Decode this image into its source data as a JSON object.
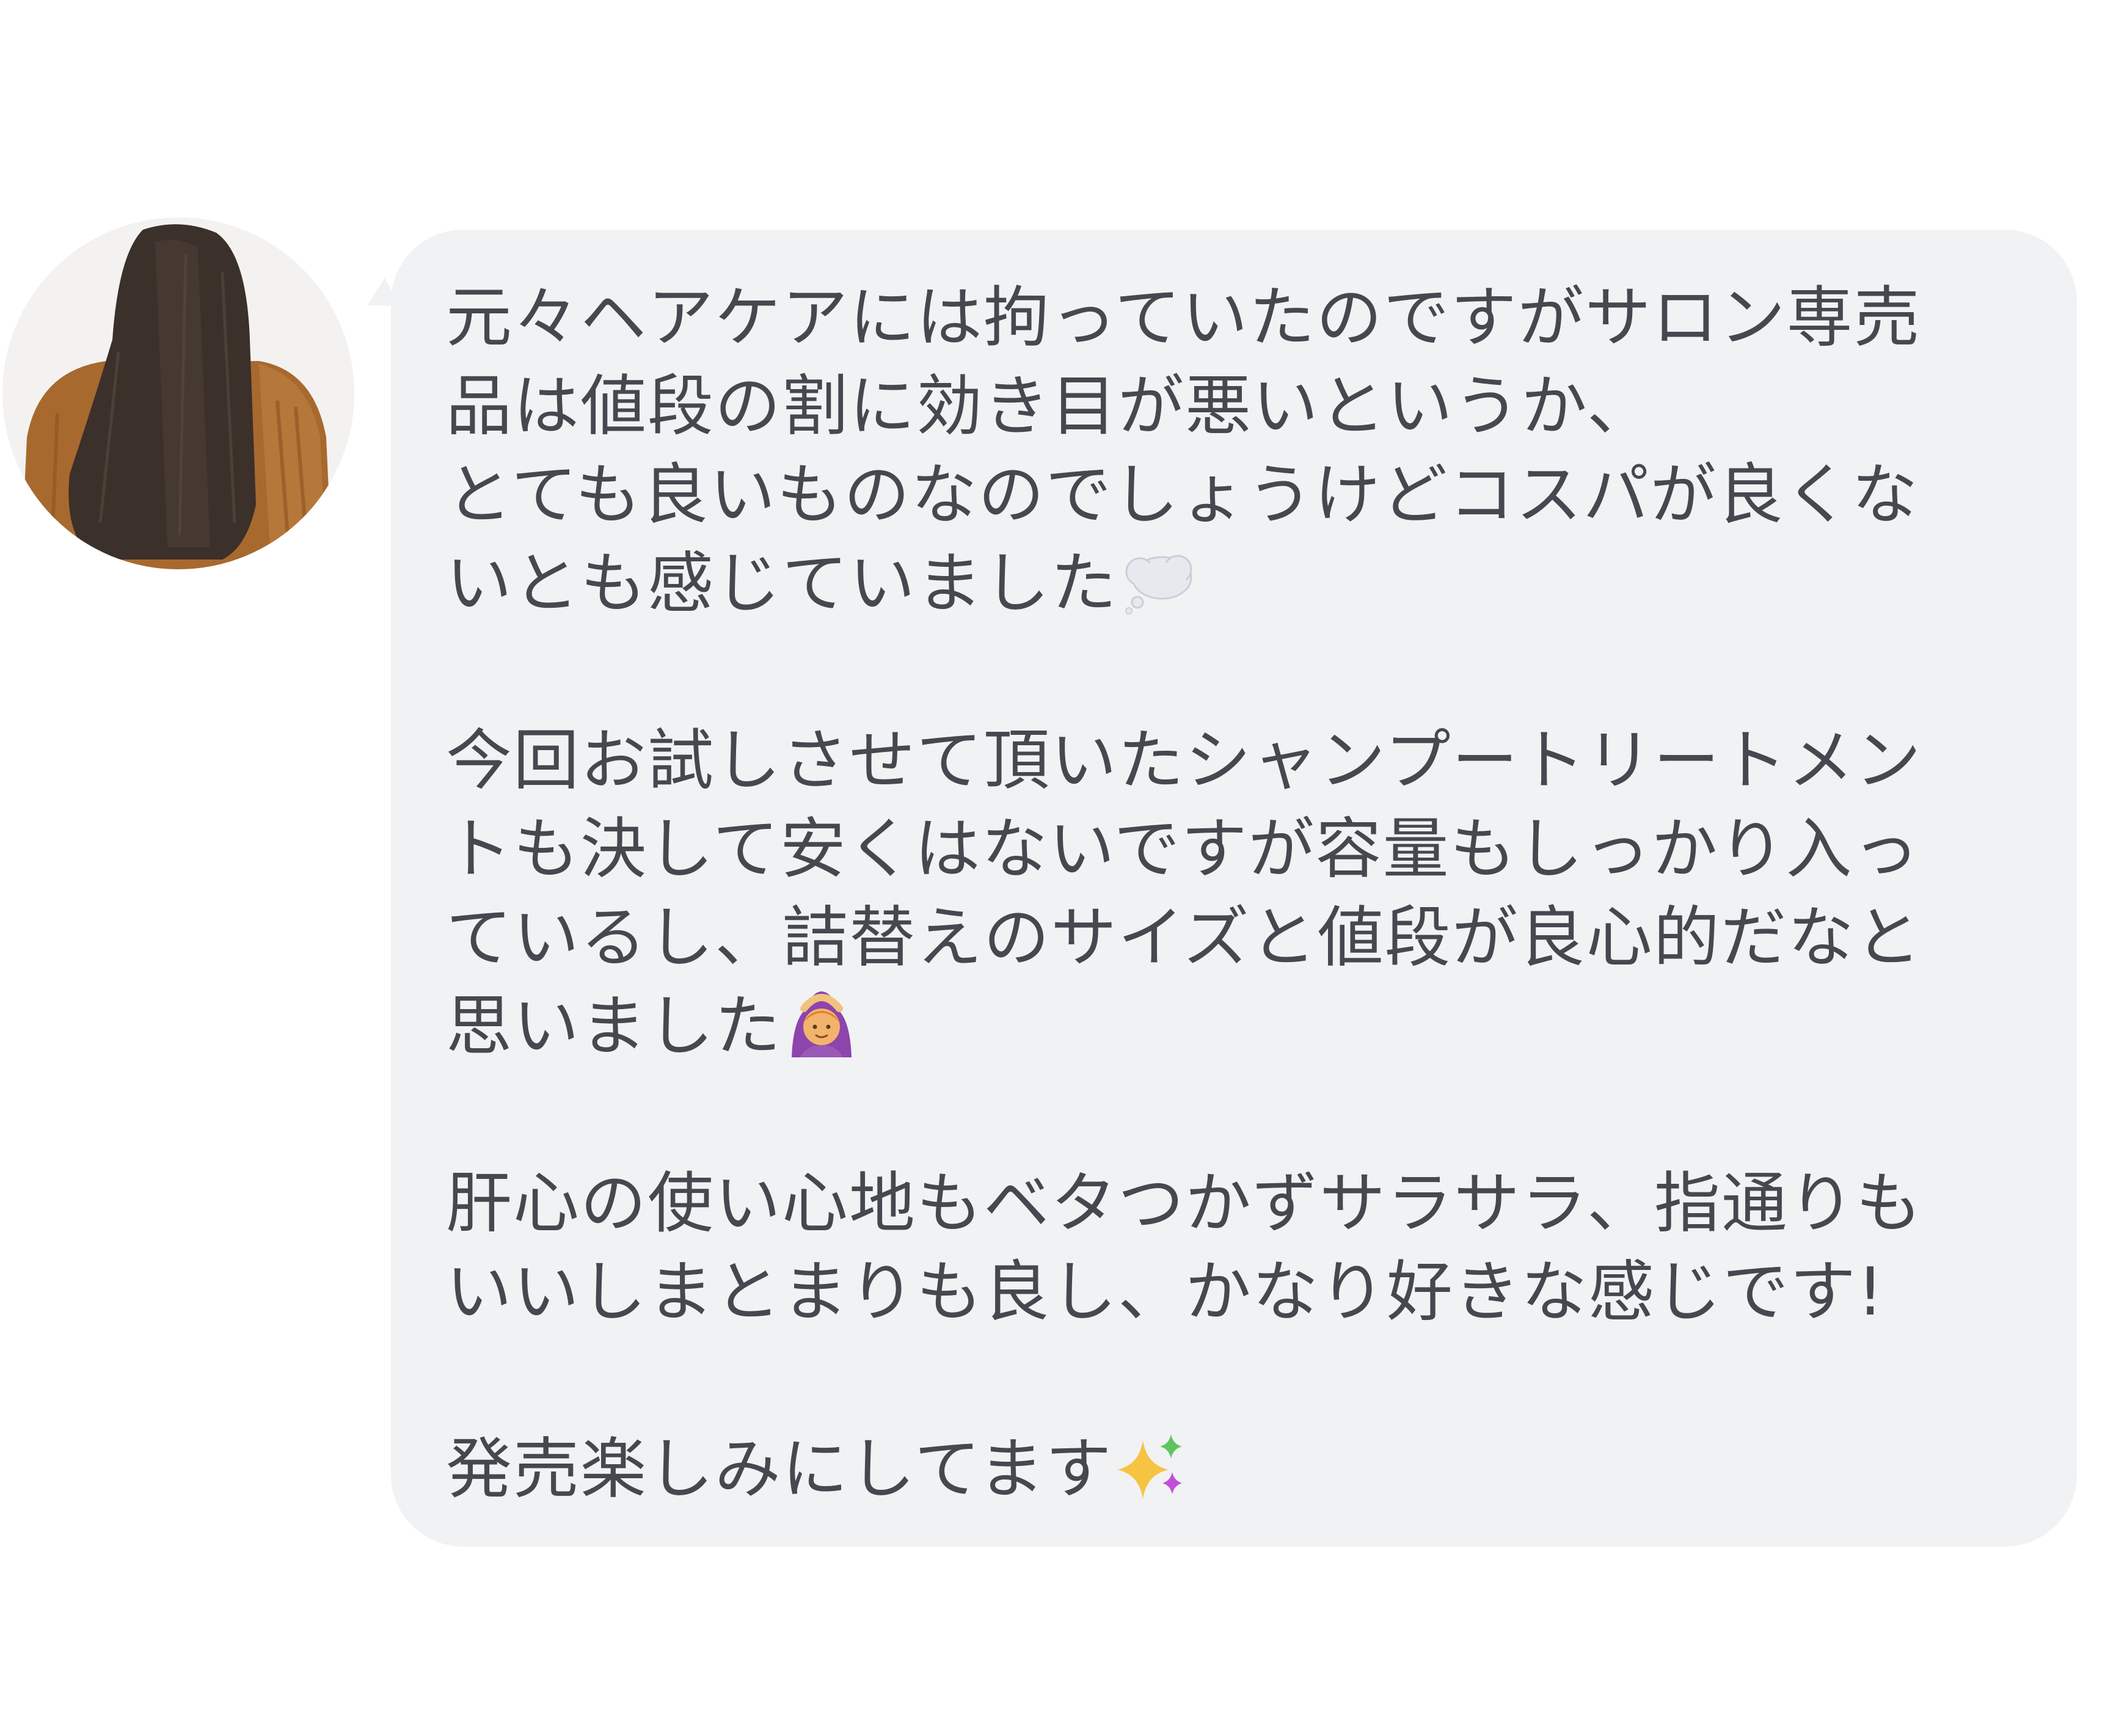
{
  "chat": {
    "sender_avatar": "avatar-photo",
    "bubble_color": "#f1f2f4",
    "text_color": "#45484f",
    "paragraphs": [
      {
        "lines": [
          "元々ヘアケアには拘っていたのですがサロン専売",
          "品は値段の割に効き目が悪いというか、",
          "とても良いものなのでしょうけどコスパが良くな",
          "いとも感じていました"
        ],
        "emoji": "thought-balloon-icon"
      },
      {
        "lines": [
          "今回お試しさせて頂いたシャンプートリートメン",
          "トも決して安くはないですが容量もしっかり入っ",
          "ているし、詰替えのサイズと値段が良心的だなと",
          "思いました"
        ],
        "emoji": "woman-gesturing-ok-icon"
      },
      {
        "lines": [
          "肝心の使い心地もベタつかずサラサラ、指通りも",
          "いいしまとまりも良し、かなり好きな感じです!"
        ]
      },
      {
        "lines": [
          "発売楽しみにしてます"
        ],
        "emoji": "sparkles-icon"
      }
    ]
  }
}
